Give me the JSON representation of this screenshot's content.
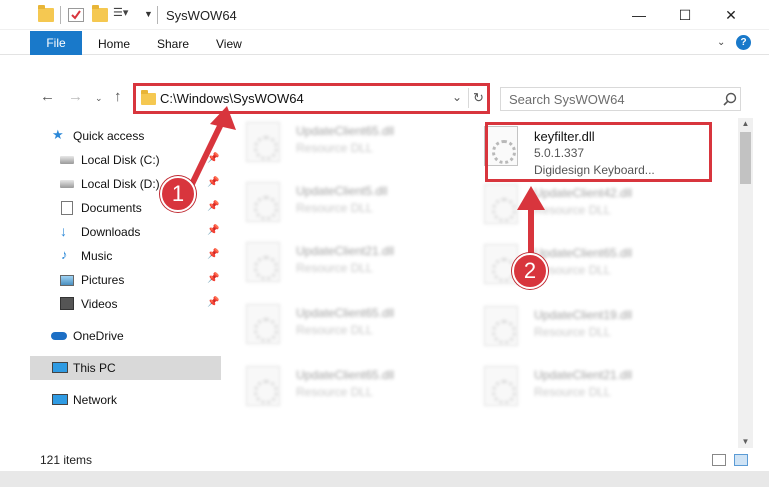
{
  "window": {
    "title": "SysWOW64",
    "minimize": "—",
    "maximize": "☐",
    "close": "✕"
  },
  "ribbon": {
    "file": "File",
    "home": "Home",
    "share": "Share",
    "view": "View",
    "help": "?"
  },
  "address": {
    "path": "C:\\Windows\\SysWOW64",
    "search_placeholder": "Search SysWOW64"
  },
  "nav": {
    "items": [
      {
        "label": "Quick access",
        "icon": "star-icon"
      },
      {
        "label": "Local Disk (C:)",
        "icon": "drive-icon",
        "pinned": true
      },
      {
        "label": "Local Disk (D:)",
        "icon": "drive-icon",
        "pinned": true
      },
      {
        "label": "Documents",
        "icon": "documents-icon",
        "pinned": true
      },
      {
        "label": "Downloads",
        "icon": "download-icon",
        "pinned": true
      },
      {
        "label": "Music",
        "icon": "music-icon",
        "pinned": true
      },
      {
        "label": "Pictures",
        "icon": "pictures-icon",
        "pinned": true
      },
      {
        "label": "Videos",
        "icon": "videos-icon",
        "pinned": true
      },
      {
        "label": "OneDrive",
        "icon": "onedrive-icon"
      },
      {
        "label": "This PC",
        "icon": "this-pc-icon",
        "selected": true
      },
      {
        "label": "Network",
        "icon": "network-icon"
      }
    ]
  },
  "files": {
    "highlighted": {
      "name": "keyfilter.dll",
      "version": "5.0.1.337",
      "description": "Digidesign Keyboard..."
    },
    "left_column": [
      {
        "name": "UpdateClient65.dll",
        "desc": "Resource DLL"
      },
      {
        "name": "UpdateClient5.dll",
        "desc": "Resource DLL"
      },
      {
        "name": "UpdateClient21.dll",
        "desc": "Resource DLL"
      },
      {
        "name": "UpdateClient65.dll",
        "desc": "Resource DLL"
      },
      {
        "name": "UpdateClient65.dll",
        "desc": "Resource DLL"
      }
    ],
    "right_column": [
      {
        "name": "UpdateClient42.dll",
        "desc": "Resource DLL"
      },
      {
        "name": "UpdateClient65.dll",
        "desc": "Resource DLL"
      },
      {
        "name": "UpdateClient19.dll",
        "desc": "Resource DLL"
      },
      {
        "name": "UpdateClient21.dll",
        "desc": "Resource DLL"
      }
    ]
  },
  "annotations": {
    "step1": "1",
    "step2": "2",
    "color": "#d8353d"
  },
  "status": {
    "item_count": "121 items"
  },
  "colors": {
    "accent": "#1979ca",
    "folder": "#f5c851",
    "selection": "#d9d9d9"
  }
}
